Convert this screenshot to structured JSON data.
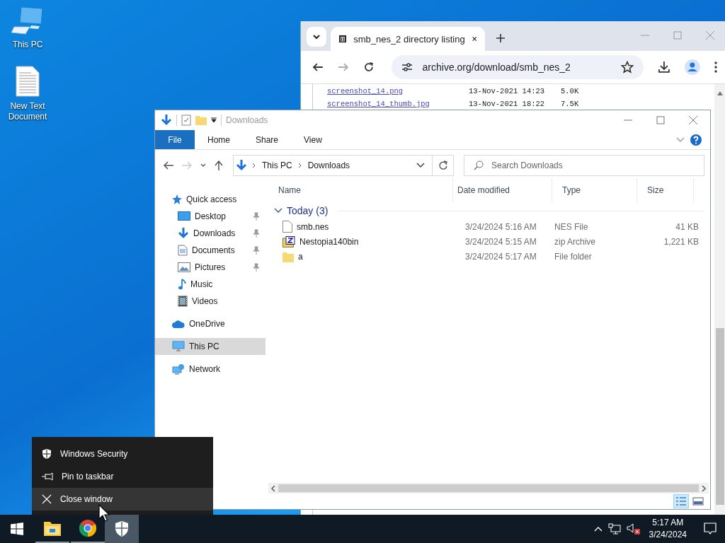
{
  "desktop_icons": [
    {
      "label": "This PC",
      "kind": "computer"
    },
    {
      "label": "New Text Document",
      "kind": "text"
    }
  ],
  "browser": {
    "tab_title": "smb_nes_2 directory listing",
    "address": "archive.org/download/smb_nes_2",
    "listing": [
      {
        "name": "screenshot_14.png",
        "date": "13-Nov-2021 14:23",
        "size": "5.0K"
      },
      {
        "name": "screenshot_14_thumb.jpg",
        "date": "13-Nov-2021 18:22",
        "size": "7.5K"
      }
    ]
  },
  "explorer": {
    "title": "Downloads",
    "ribbon_tabs": [
      {
        "label": "File",
        "kind": "file"
      },
      {
        "label": "Home",
        "kind": "tab"
      },
      {
        "label": "Share",
        "kind": "tab"
      },
      {
        "label": "View",
        "kind": "tab"
      }
    ],
    "breadcrumb": [
      "This PC",
      "Downloads"
    ],
    "search": {
      "placeholder": "Search Downloads"
    },
    "nav": [
      {
        "label": "Quick access",
        "kind": "star",
        "selected": false,
        "children": [
          {
            "label": "Desktop",
            "kind": "desktop",
            "pinned": true,
            "selected": false
          },
          {
            "label": "Downloads",
            "kind": "download",
            "pinned": true,
            "selected": false
          },
          {
            "label": "Documents",
            "kind": "documents",
            "pinned": true,
            "selected": false
          },
          {
            "label": "Pictures",
            "kind": "pictures",
            "pinned": true,
            "selected": false
          },
          {
            "label": "Music",
            "kind": "music",
            "pinned": false,
            "selected": false
          },
          {
            "label": "Videos",
            "kind": "videos",
            "pinned": false,
            "selected": false
          }
        ]
      },
      {
        "label": "OneDrive",
        "kind": "cloud",
        "selected": false
      },
      {
        "label": "This PC",
        "kind": "pc",
        "selected": true
      },
      {
        "label": "Network",
        "kind": "network",
        "selected": false
      }
    ],
    "columns": [
      "Name",
      "Date modified",
      "Type",
      "Size"
    ],
    "group": {
      "label": "Today (3)",
      "expanded": true
    },
    "files": [
      {
        "name": "smb.nes",
        "date": "3/24/2024 5:16 AM",
        "type": "NES File",
        "size": "41 KB",
        "kind": "file"
      },
      {
        "name": "Nestopia140bin",
        "date": "3/24/2024 5:15 AM",
        "type": "zip Archive",
        "size": "1,221 KB",
        "kind": "zip"
      },
      {
        "name": "a",
        "date": "3/24/2024 5:17 AM",
        "type": "File folder",
        "kind": "folder"
      }
    ],
    "view_buttons": [
      {
        "kind": "details",
        "selected": true
      },
      {
        "kind": "tiles",
        "selected": false
      }
    ]
  },
  "context_menu": [
    {
      "label": "Windows Security",
      "kind": "shield",
      "selected": false
    },
    {
      "label": "Pin to taskbar",
      "kind": "pin",
      "selected": false
    },
    {
      "label": "Close window",
      "kind": "close",
      "selected": true
    }
  ],
  "taskbar": {
    "apps": [
      {
        "kind": "explorer",
        "running": true,
        "selected": false
      },
      {
        "kind": "chrome",
        "running": true,
        "selected": false
      },
      {
        "kind": "shield",
        "running": false,
        "selected": true
      }
    ],
    "time": "5:17 AM",
    "date": "3/24/2024"
  }
}
